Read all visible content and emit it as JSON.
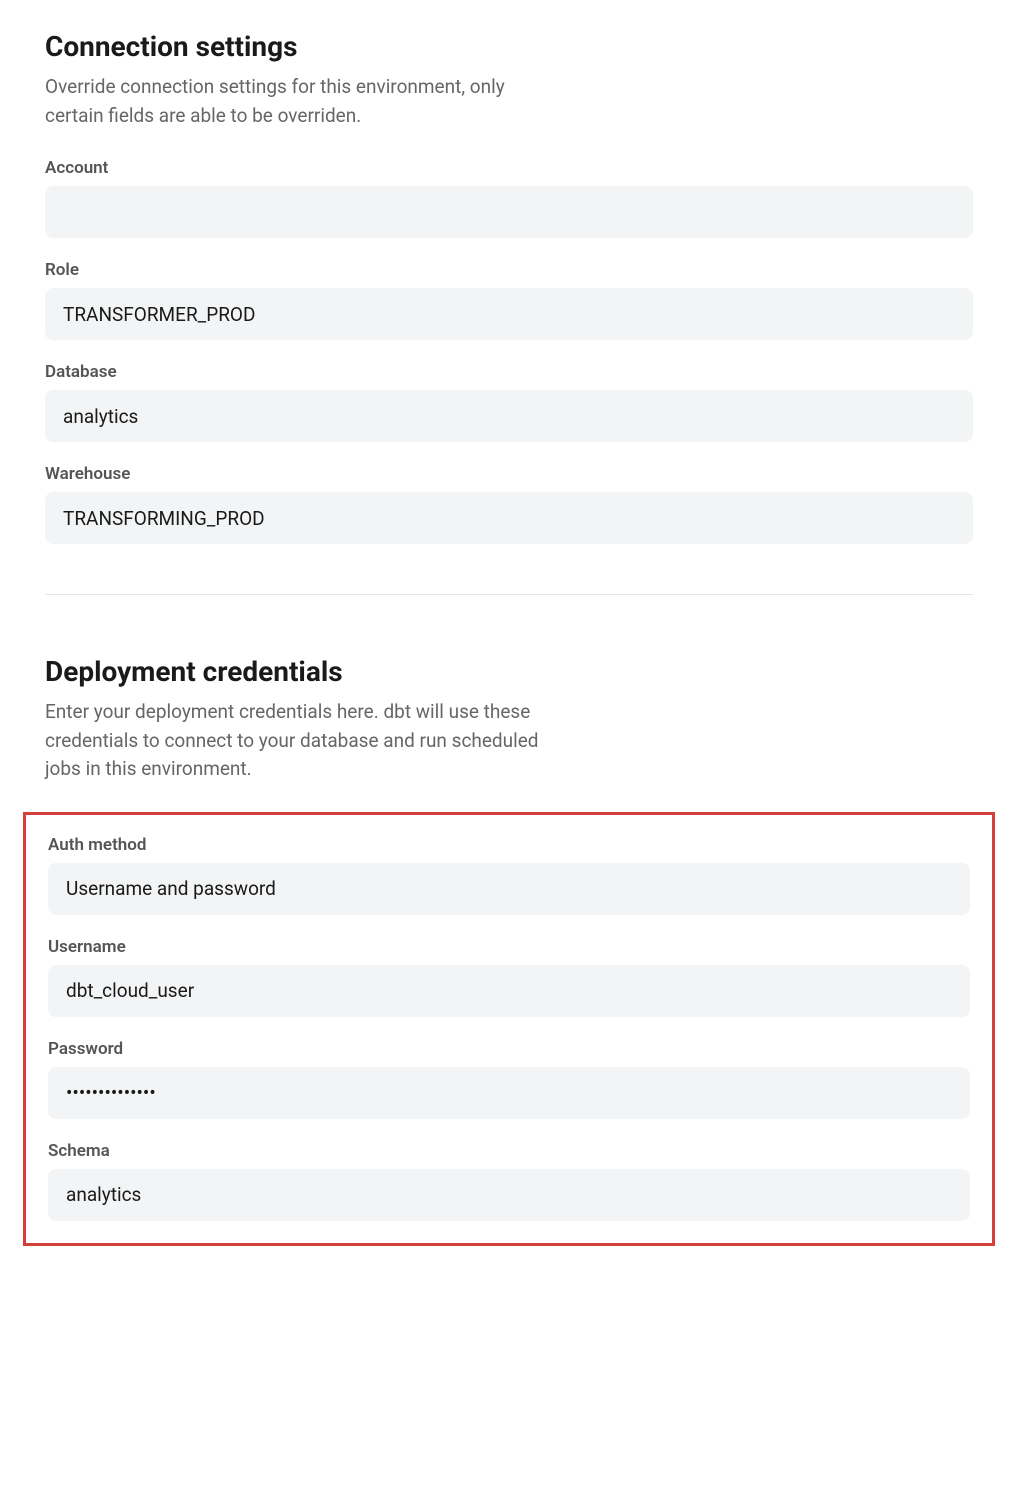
{
  "connection": {
    "title": "Connection settings",
    "description": "Override connection settings for this environment, only certain fields are able to be overriden.",
    "fields": {
      "account": {
        "label": "Account",
        "value": ""
      },
      "role": {
        "label": "Role",
        "value": "TRANSFORMER_PROD"
      },
      "database": {
        "label": "Database",
        "value": "analytics"
      },
      "warehouse": {
        "label": "Warehouse",
        "value": "TRANSFORMING_PROD"
      }
    }
  },
  "deployment": {
    "title": "Deployment credentials",
    "description": "Enter your deployment credentials here. dbt will use these credentials to connect to your database and run scheduled jobs in this environment.",
    "fields": {
      "auth_method": {
        "label": "Auth method",
        "value": "Username and password"
      },
      "username": {
        "label": "Username",
        "value": "dbt_cloud_user"
      },
      "password": {
        "label": "Password",
        "value": "••••••••••••••"
      },
      "schema": {
        "label": "Schema",
        "value": "analytics"
      }
    }
  }
}
